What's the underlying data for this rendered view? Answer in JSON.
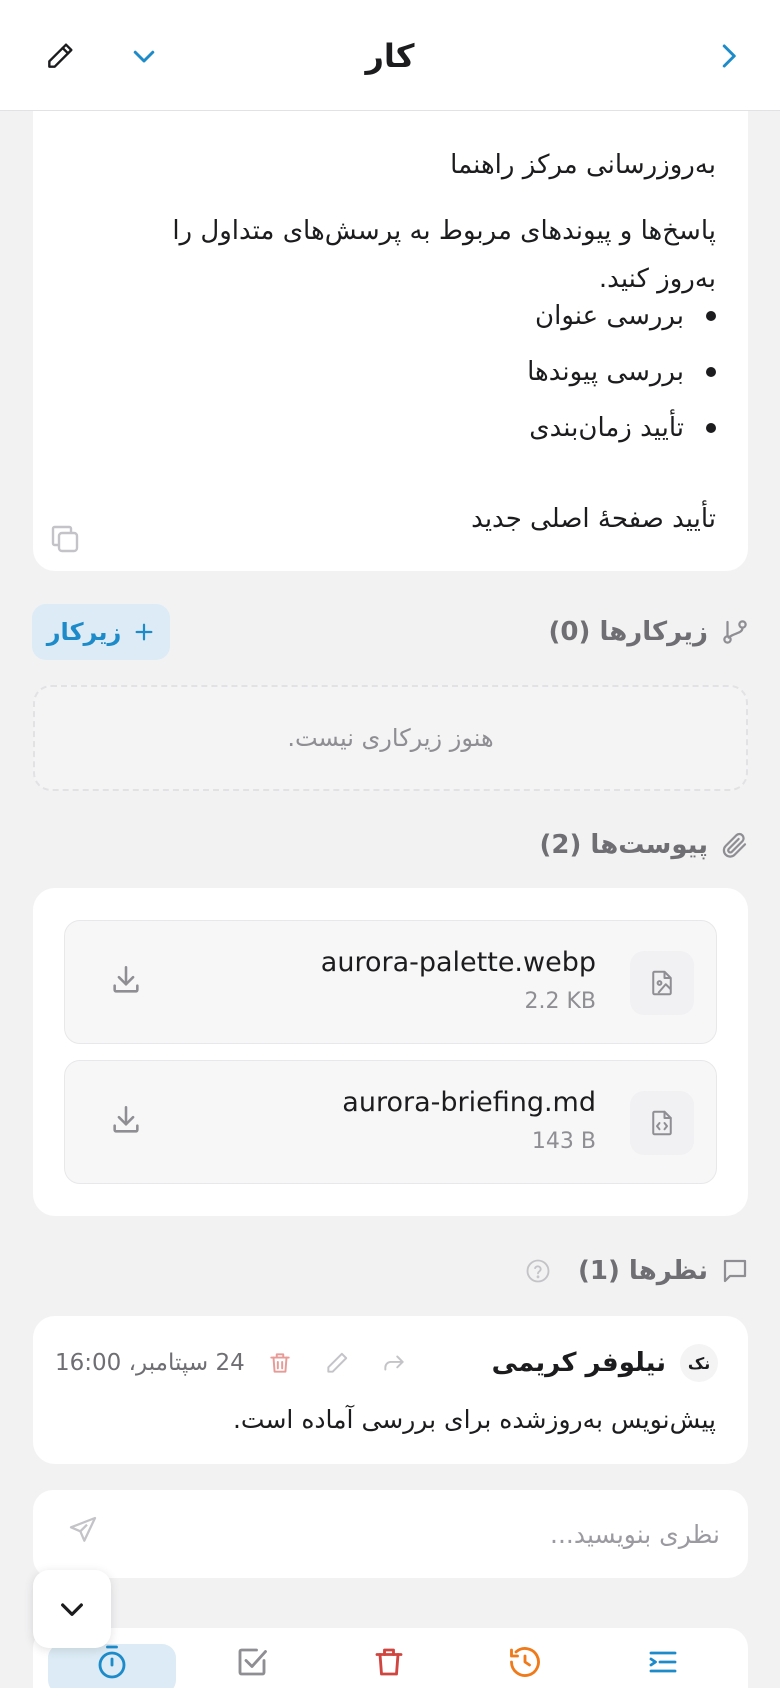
{
  "header": {
    "title": "کار"
  },
  "description": {
    "heading": "به‌روزرسانی مرکز راهنما",
    "paragraph_line1": "پاسخ‌ها و پیوندهای مربوط به پرسش‌های متداول را",
    "paragraph_line2": "به‌روز کنید.",
    "bullets": [
      "بررسی عنوان",
      "بررسی پیوندها",
      "تأیید زمان‌بندی"
    ],
    "closing": "تأیید صفحهٔ اصلی جدید"
  },
  "subtasks": {
    "title": "زیرکارها (0)",
    "add_label": "زیرکار",
    "empty_text": "هنوز زیرکاری نیست."
  },
  "attachments": {
    "title": "پیوست‌ها (2)",
    "files": [
      {
        "name": "aurora-palette.webp",
        "size": "2.2 KB",
        "type": "image"
      },
      {
        "name": "aurora-briefing.md",
        "size": "143 B",
        "type": "code"
      }
    ]
  },
  "comments": {
    "title": "نظرها (1)",
    "items": [
      {
        "avatar": "نک",
        "author": "نیلوفر کریمی",
        "timestamp": "24 سپتامبر، 16:00",
        "text": "پیش‌نویس به‌روزشده برای بررسی آماده است."
      }
    ],
    "input_placeholder": "نظری بنویسید..."
  },
  "colors": {
    "accent": "#1d8bc9",
    "danger": "#d0453f",
    "warning": "#f07a1a"
  },
  "icons": {
    "back": "chevron-right-icon",
    "expand": "chevron-down-icon",
    "edit": "pencil-icon"
  }
}
